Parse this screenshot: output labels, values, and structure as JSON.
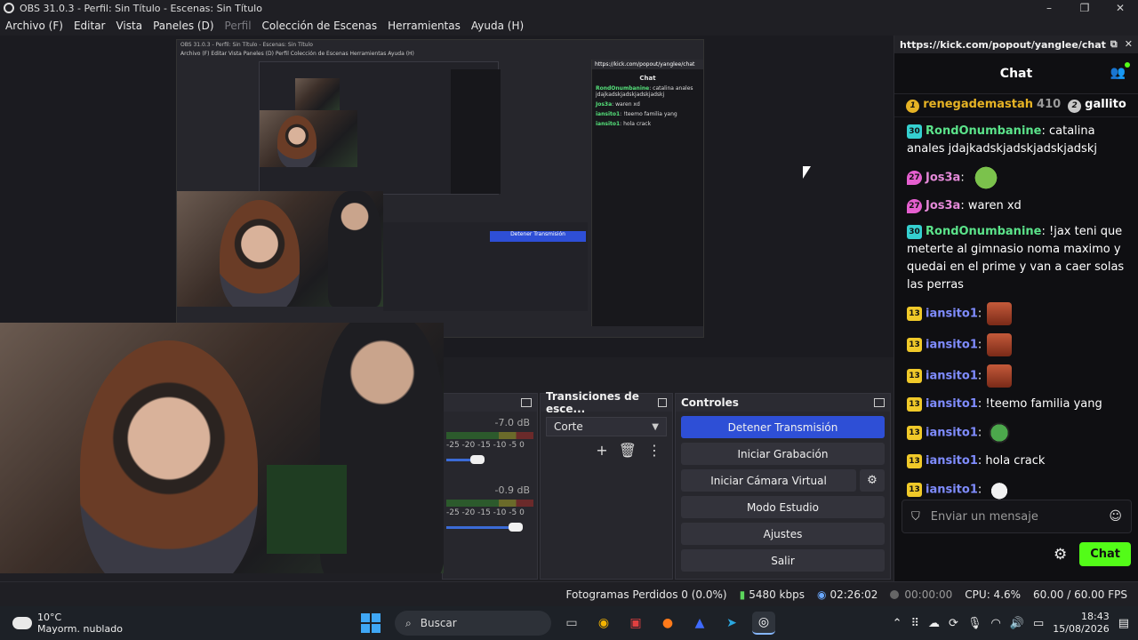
{
  "window": {
    "title": "OBS 31.0.3 - Perfil: Sin Título - Escenas: Sin Título",
    "controls": [
      "–",
      "❐",
      "✕"
    ]
  },
  "menu": [
    "Archivo (F)",
    "Editar",
    "Vista",
    "Paneles (D)",
    "Perfil",
    "Colección de Escenas",
    "Herramientas",
    "Ayuda (H)"
  ],
  "preview_nested": {
    "title": "OBS 31.0.3 - Perfil: Sin Título - Escenas: Sin Título",
    "menu": "Archivo (F)   Editar   Vista   Paneles (D)   Perfil   Colección de Escenas   Herramientas   Ayuda (H)",
    "chat_url": "https://kick.com/popout/yanglee/chat",
    "chat_title": "Chat",
    "chat_lines": [
      {
        "user": "RondOnumbanine",
        "text": ": catalina anales jdajkadskjadskjadskjadskj"
      },
      {
        "user": "Jos3a",
        "text": ": waren xd"
      },
      {
        "user": "iansito1",
        "text": ": !teemo familia yang"
      },
      {
        "user": "iansito1",
        "text": ": hola crack"
      }
    ]
  },
  "mixer": {
    "channels": [
      {
        "db": "-7.0 dB",
        "scale": "-25  -20  -15  -10   -5   0",
        "level": 0.35
      },
      {
        "db": "-0.9 dB",
        "scale": "-25  -20  -15  -10   -5   0",
        "level": 0.78
      }
    ]
  },
  "transitions": {
    "title": "Transiciones de esce...",
    "selected": "Corte",
    "tools": [
      "+",
      "🗑",
      "⋮"
    ]
  },
  "controls": {
    "title": "Controles",
    "stop_stream": "Detener Transmisión",
    "start_recording": "Iniciar Grabación",
    "start_virtual_cam": "Iniciar Cámara Virtual",
    "studio_mode": "Modo Estudio",
    "settings": "Ajustes",
    "exit": "Salir"
  },
  "status": {
    "dropped_frames": "Fotogramas Perdidos 0 (0.0%)",
    "bitrate": "5480 kbps",
    "stream_time": "02:26:02",
    "rec_time": "00:00:00",
    "cpu": "CPU: 4.6%",
    "fps": "60.00 / 60.00 FPS"
  },
  "chat": {
    "url": "https://kick.com/popout/yanglee/chat",
    "title": "Chat",
    "top_gifters": [
      {
        "rank": "1",
        "name": "renegademastah",
        "count": "410"
      },
      {
        "rank": "2",
        "name": "gallito"
      }
    ],
    "messages": [
      {
        "badge": "30",
        "badge_type": "b30",
        "user": "RondOnumbanine",
        "user_color": "green",
        "text": ": catalina anales jdajkadskjadskjadskjadskj",
        "emote": ""
      },
      {
        "badge": "27",
        "badge_type": "b27",
        "user": "Jos3a",
        "user_color": "pink",
        "text": ":",
        "emote": "frog"
      },
      {
        "badge": "27",
        "badge_type": "b27",
        "user": "Jos3a",
        "user_color": "pink",
        "text": ": waren xd",
        "emote": ""
      },
      {
        "badge": "30",
        "badge_type": "b30",
        "user": "RondOnumbanine",
        "user_color": "green",
        "text": ": !jax teni que meterte al gimnasio noma maximo y quedai en el prime y van a caer solas las perras",
        "emote": ""
      },
      {
        "badge": "13",
        "badge_type": "b13",
        "user": "iansito1",
        "user_color": "blue",
        "text": ":",
        "emote": "face"
      },
      {
        "badge": "13",
        "badge_type": "b13",
        "user": "iansito1",
        "user_color": "blue",
        "text": ":",
        "emote": "face"
      },
      {
        "badge": "13",
        "badge_type": "b13",
        "user": "iansito1",
        "user_color": "blue",
        "text": ":",
        "emote": "face"
      },
      {
        "badge": "13",
        "badge_type": "b13",
        "user": "iansito1",
        "user_color": "blue",
        "text": ": !teemo familia yang",
        "emote": ""
      },
      {
        "badge": "13",
        "badge_type": "b13",
        "user": "iansito1",
        "user_color": "blue",
        "text": ":",
        "emote": "pepe"
      },
      {
        "badge": "13",
        "badge_type": "b13",
        "user": "iansito1",
        "user_color": "blue",
        "text": ": hola crack",
        "emote": ""
      },
      {
        "badge": "13",
        "badge_type": "b13",
        "user": "iansito1",
        "user_color": "blue",
        "text": ":",
        "emote": "cat"
      }
    ],
    "input_placeholder": "Enviar un mensaje",
    "send_label": "Chat"
  },
  "taskbar": {
    "weather_temp": "10°C",
    "weather_desc": "Mayorm. nublado",
    "search_placeholder": "Buscar",
    "time": "18:43",
    "date": "15/08/2026"
  },
  "colors": {
    "accent_blue": "#2e4fd6",
    "kick_green": "#53fc18"
  }
}
